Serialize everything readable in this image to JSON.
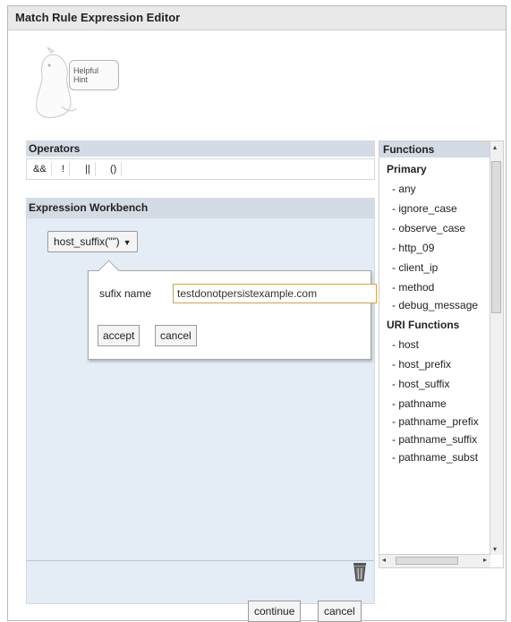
{
  "window": {
    "title": "Match Rule Expression Editor"
  },
  "hint": {
    "text": "Helpful Hint"
  },
  "operators": {
    "header": "Operators",
    "items": [
      "&&",
      "!",
      "||",
      "()"
    ]
  },
  "workbench": {
    "header": "Expression Workbench",
    "expression_label": "host_suffix(\"\")",
    "popup": {
      "field_label": "sufix name",
      "field_value": "testdonotpersistexample.com",
      "accept_label": "accept",
      "cancel_label": "cancel"
    }
  },
  "functions": {
    "header": "Functions",
    "groups": [
      {
        "name": "Primary",
        "items": [
          "- any",
          "- ignore_case",
          "- observe_case",
          "- http_09",
          "- client_ip",
          "- method",
          "- debug_message"
        ]
      },
      {
        "name": "URI Functions",
        "items": [
          "- host",
          "- host_prefix",
          "- host_suffix",
          "- pathname",
          "- pathname_prefix",
          "- pathname_suffix",
          "- pathname_subst"
        ]
      }
    ],
    "hscroll_arrow_left": "◂",
    "hscroll_arrow_right": "▸",
    "vscroll_arrow_up": "▴",
    "vscroll_arrow_down": "▾"
  },
  "footer": {
    "continue_label": "continue",
    "cancel_label": "cancel"
  }
}
